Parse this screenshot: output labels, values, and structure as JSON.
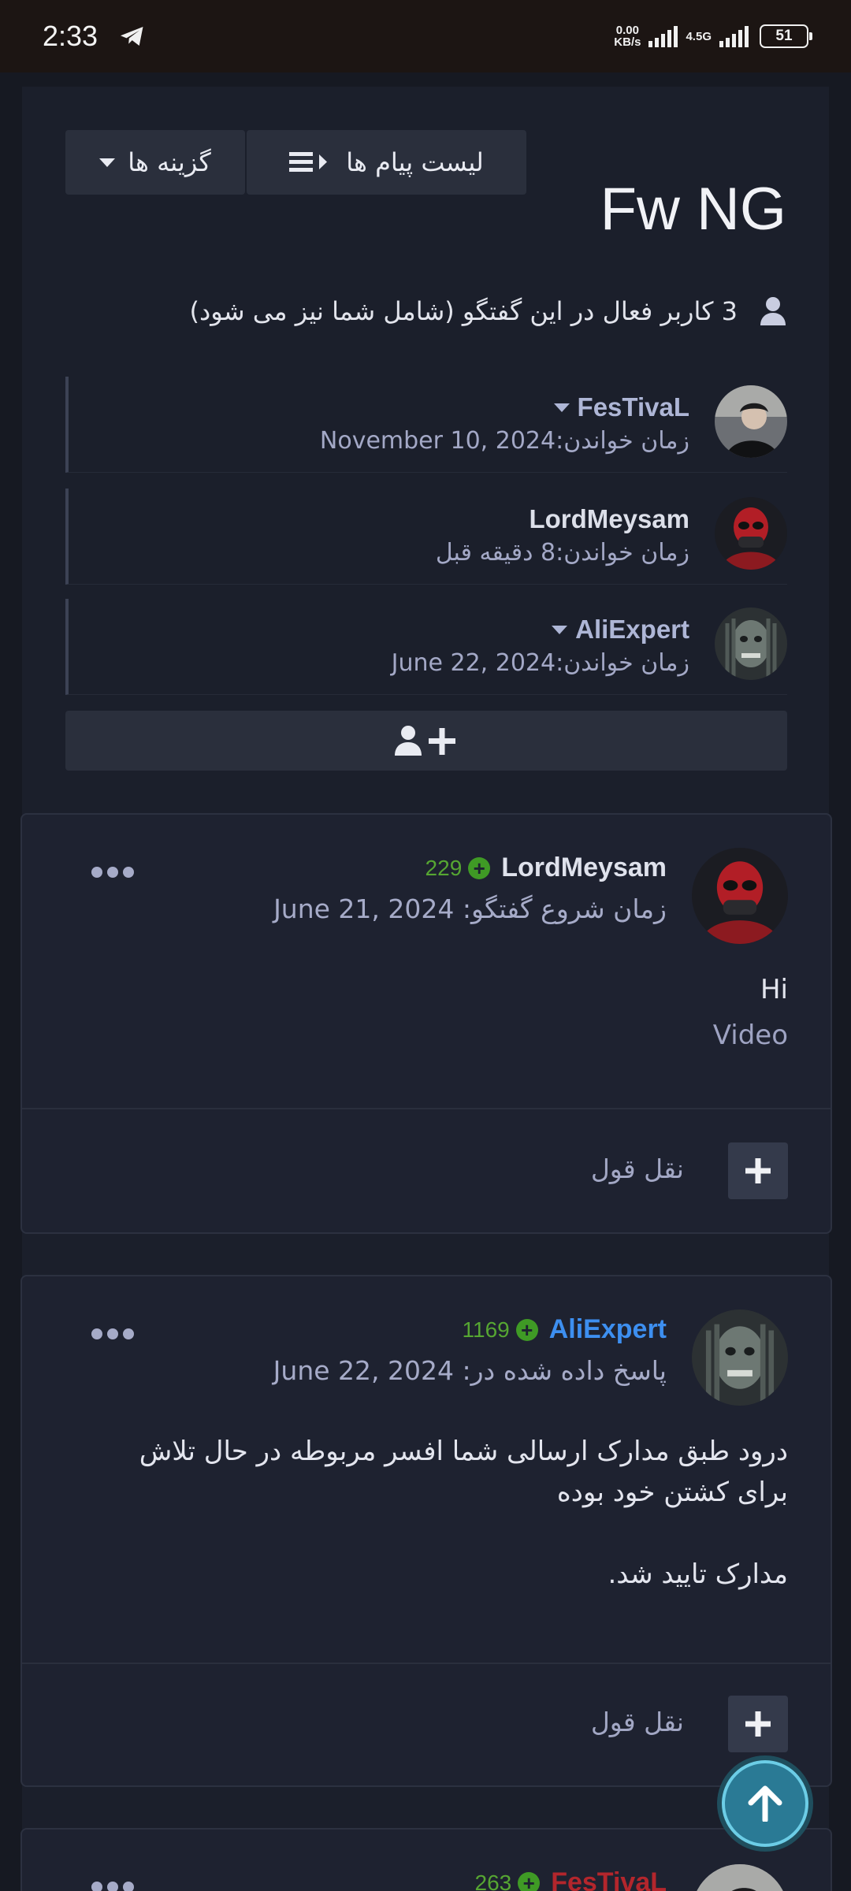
{
  "status_bar": {
    "time": "2:33",
    "speed_value": "0.00",
    "speed_unit": "KB/s",
    "network": "4.5G",
    "battery": "51"
  },
  "header": {
    "title": "Fw NG",
    "options_label": "گزینه ها",
    "message_list_label": "لیست پیام ها"
  },
  "active_users": {
    "text": "3 کاربر فعال در این گفتگو (شامل شما نیز می شود)"
  },
  "viewers": [
    {
      "name": "FesTivaL",
      "read_time": "زمان خواندن:November 10, 2024"
    },
    {
      "name": "LordMeysam",
      "read_time": "زمان خواندن:8 دقیقه قبل"
    },
    {
      "name": "AliExpert",
      "read_time": "زمان خواندن:June 22, 2024"
    }
  ],
  "posts": [
    {
      "author": "LordMeysam",
      "reputation": "229",
      "meta": "زمان شروع گفتگو: June 21, 2024",
      "body_line1": "Hi",
      "body_line2": "Video",
      "quote_label": "نقل قول"
    },
    {
      "author": "AliExpert",
      "reputation": "1169",
      "meta": "پاسخ داده شده در: June 22, 2024",
      "body_line1": "درود طبق مدارک ارسالی شما افسر مربوطه در حال تلاش برای کشتن خود بوده",
      "body_line2": "مدارک تایید شد.",
      "quote_label": "نقل قول"
    },
    {
      "author": "FesTivaL",
      "reputation": "263"
    }
  ],
  "colors": {
    "background": "#161922",
    "accent_blue": "#3d8ff0",
    "reputation_green": "#56a632",
    "festival_red": "#b3262c"
  }
}
